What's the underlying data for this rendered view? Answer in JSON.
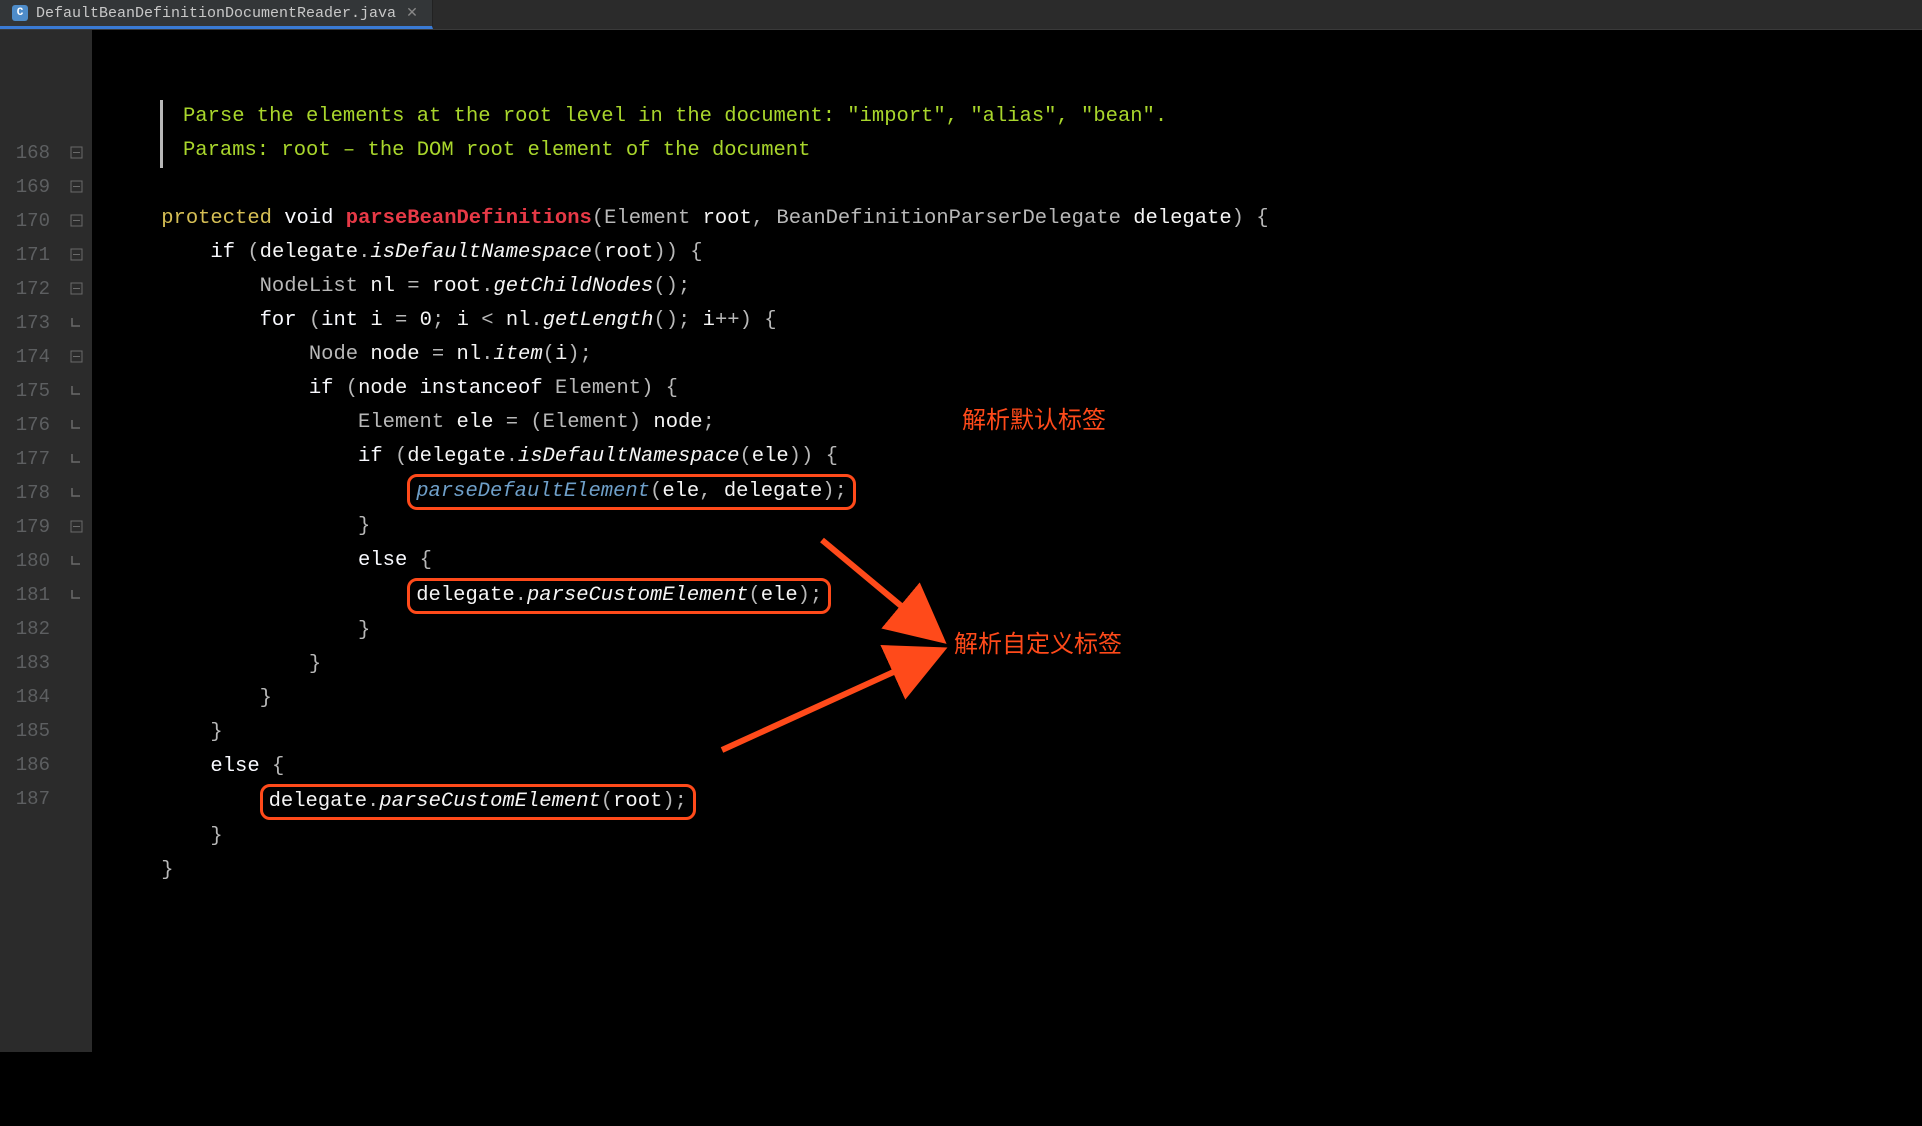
{
  "tab": {
    "title": "DefaultBeanDefinitionDocumentReader.java",
    "close": "✕",
    "icon": "C"
  },
  "line_start": 168,
  "line_count": 20,
  "doc": {
    "line1": "Parse the elements at the root level in the document: \"import\", \"alias\", \"bean\".",
    "line2": "Params: root – the DOM root element of the document"
  },
  "code": {
    "protected": "protected",
    "void": "void",
    "method": "parseBeanDefinitions",
    "param1type": "Element",
    "param1": "root",
    "param2type": "BeanDefinitionParserDelegate",
    "param2": "delegate",
    "if": "if",
    "for": "for",
    "else": "else",
    "int": "int",
    "instanceof": "instanceof",
    "isDefaultNamespace": "isDefaultNamespace",
    "getChildNodes": "getChildNodes",
    "getLength": "getLength",
    "item": "item",
    "parseDefaultElement": "parseDefaultElement",
    "parseCustomElement": "parseCustomElement",
    "NodeList": "NodeList",
    "Node": "Node",
    "Element": "Element",
    "nl": "nl",
    "i": "i",
    "zero": "0",
    "node": "node",
    "ele": "ele",
    "delegate": "delegate",
    "root": "root"
  },
  "annotations": {
    "default_tag": "解析默认标签",
    "custom_tag": "解析自定义标签"
  }
}
